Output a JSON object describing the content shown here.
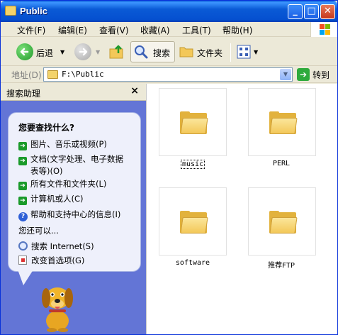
{
  "window": {
    "title": "Public"
  },
  "menu": {
    "items": [
      "文件(F)",
      "编辑(E)",
      "查看(V)",
      "收藏(A)",
      "工具(T)",
      "帮助(H)"
    ]
  },
  "toolbar": {
    "back_label": "后退",
    "search_label": "搜索",
    "folders_label": "文件夹"
  },
  "address": {
    "label": "地址(D)",
    "value": "F:\\Public",
    "go_label": "转到"
  },
  "search_pane": {
    "title": "搜索助理",
    "heading": "您要查找什么?",
    "options": [
      "图片、音乐或视频(P)",
      "文档(文字处理、电子数据",
      "表等)(O)",
      "所有文件和文件夹(L)",
      "计算机或人(C)",
      "帮助和支持中心的信息(I)"
    ],
    "more_label": "您还可以...",
    "extra": [
      "搜索 Internet(S)",
      "改变首选项(G)"
    ]
  },
  "files": [
    {
      "name": "music"
    },
    {
      "name": "PERL"
    },
    {
      "name": "software"
    },
    {
      "name": "推荐FTP"
    }
  ],
  "colors": {
    "title_bar": "#0a5ad6",
    "pane_background": "#6375d6",
    "folder": "#f3c859"
  }
}
